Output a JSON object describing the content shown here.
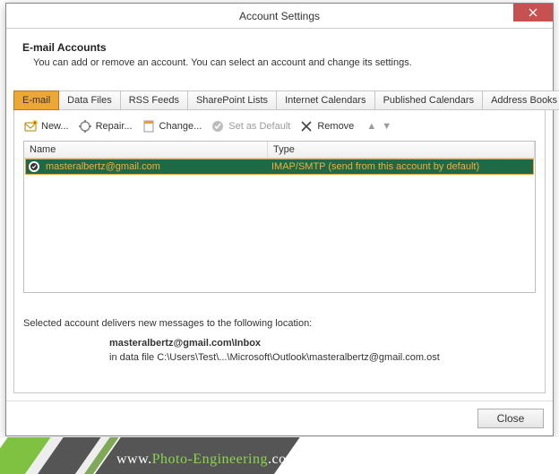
{
  "titlebar": {
    "title": "Account Settings"
  },
  "header": {
    "title": "E-mail Accounts",
    "subtitle": "You can add or remove an account. You can select an account and change its settings."
  },
  "tabs": [
    {
      "label": "E-mail",
      "active": true
    },
    {
      "label": "Data Files"
    },
    {
      "label": "RSS Feeds"
    },
    {
      "label": "SharePoint Lists"
    },
    {
      "label": "Internet Calendars"
    },
    {
      "label": "Published Calendars"
    },
    {
      "label": "Address Books"
    }
  ],
  "toolbar": {
    "new": "New...",
    "repair": "Repair...",
    "change": "Change...",
    "set_default": "Set as Default",
    "remove": "Remove"
  },
  "table": {
    "headers": {
      "name": "Name",
      "type": "Type"
    },
    "rows": [
      {
        "name": "masteralbertz@gmail.com",
        "type": "IMAP/SMTP (send from this account by default)",
        "selected": true,
        "default": true
      }
    ]
  },
  "info": {
    "line1": "Selected account delivers new messages to the following location:",
    "location_bold": "masteralbertz@gmail.com\\Inbox",
    "line3": "in data file C:\\Users\\Test\\...\\Microsoft\\Outlook\\masteralbertz@gmail.com.ost"
  },
  "footer": {
    "close": "Close"
  },
  "watermark": {
    "prefix": "www.",
    "main": "Photo-Engineering",
    "suffix": ".com"
  }
}
